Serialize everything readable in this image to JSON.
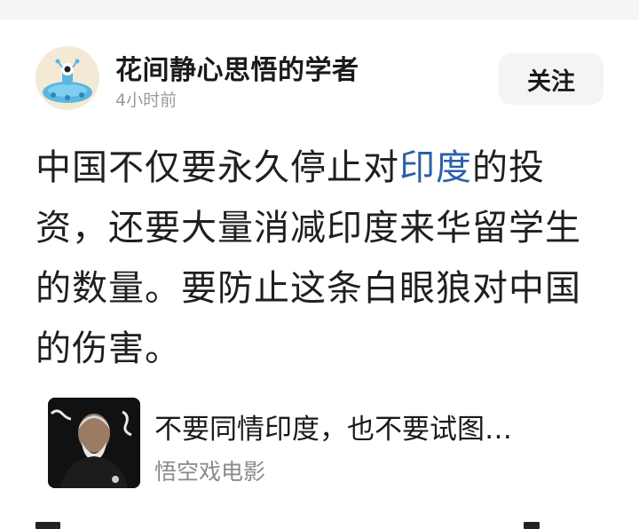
{
  "author": {
    "name": "花间静心思悟的学者",
    "time": "4小时前",
    "avatar_icon": "alien-ufo-avatar-icon"
  },
  "follow_label": "关注",
  "post": {
    "text_before": "中国不仅要永久停止对",
    "topic": "印度",
    "text_after": "的投资，还要大量消减印度来华留学生的数量。要防止这条白眼狼对中国的伤害。"
  },
  "link_card": {
    "title": "不要同情印度，也不要试图…",
    "source": "悟空戏电影",
    "thumbnail_icon": "video-thumbnail-icon"
  },
  "colors": {
    "link": "#2b5fa8",
    "muted": "#9a9a9a",
    "button_bg": "#f3f4f6"
  }
}
